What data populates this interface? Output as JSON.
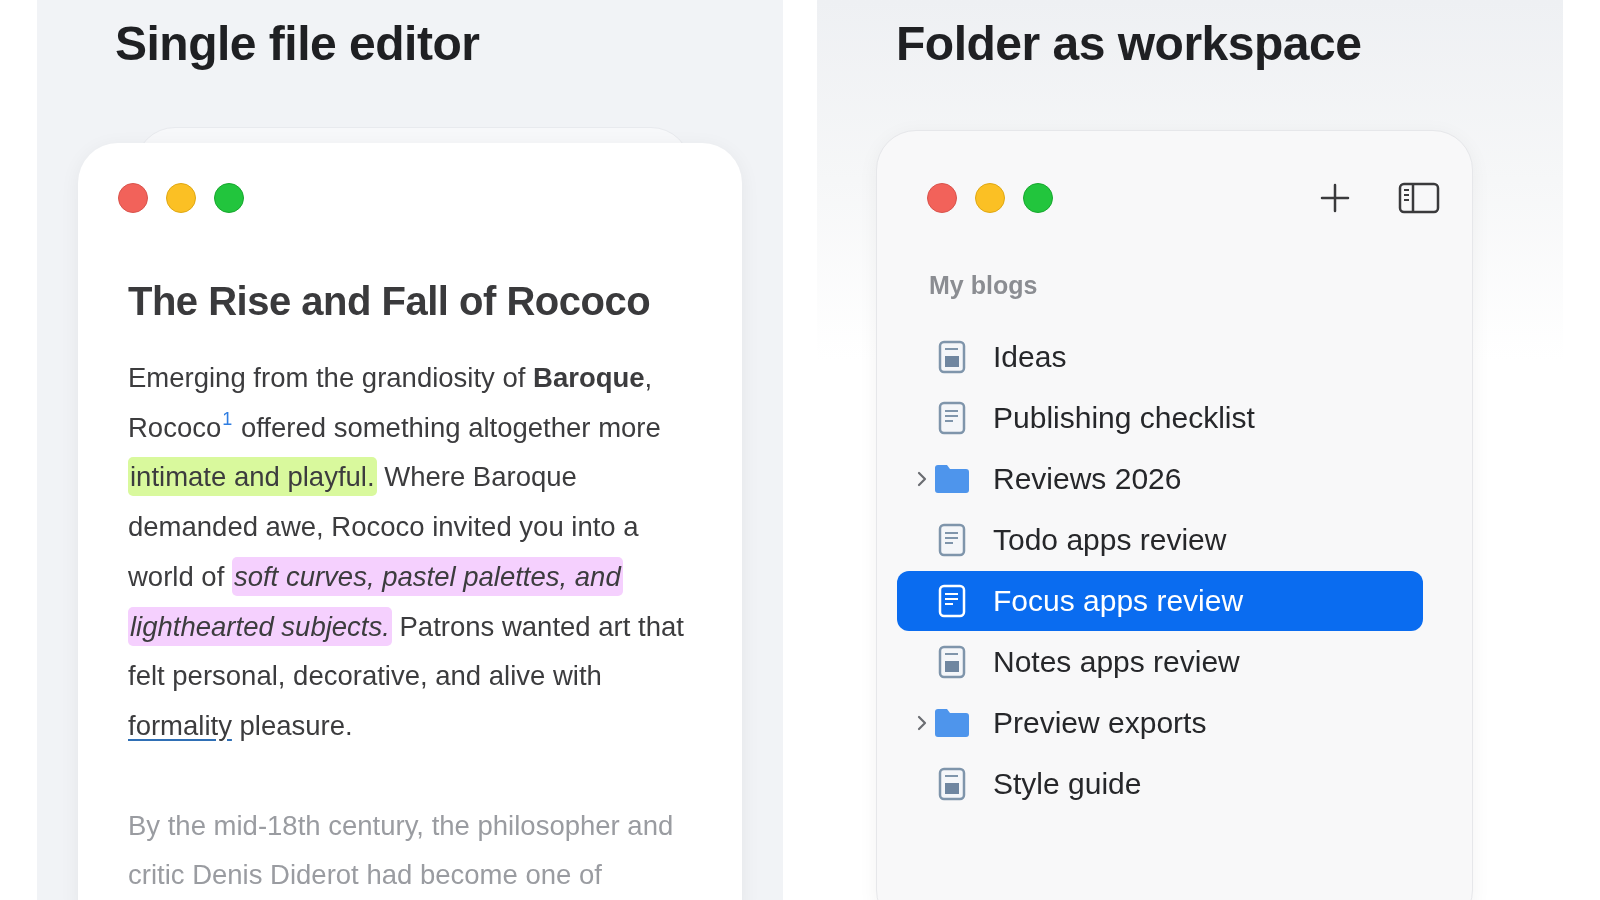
{
  "panels": [
    {
      "kind": "editor",
      "title": "Single file editor",
      "window": {
        "heading": "The Rise and Fall of Rococo",
        "paragraphs": [
          {
            "faded": false,
            "segments": [
              {
                "kind": "text",
                "text": "Emerging from the grandiosity of "
              },
              {
                "kind": "bold",
                "text": "Baroque"
              },
              {
                "kind": "text",
                "text": ", Rococo"
              },
              {
                "kind": "footnote",
                "text": "1"
              },
              {
                "kind": "text",
                "text": " offered something altogether more "
              },
              {
                "kind": "highlight",
                "text": "intimate and playful.",
                "color": "#d9f99d",
                "italic": false
              },
              {
                "kind": "text",
                "text": " Where Baroque demanded awe, Rococo invited you into a world of "
              },
              {
                "kind": "highlight",
                "text": "soft curves, pastel palettes, and lighthearted subjects.",
                "color": "#f5d0fe",
                "italic": true
              },
              {
                "kind": "text",
                "text": " Patrons wanted art that felt personal, decorative, and alive with "
              },
              {
                "kind": "link",
                "text": "formality"
              },
              {
                "kind": "text",
                "text": " pleasure."
              }
            ]
          },
          {
            "faded": true,
            "segments": [
              {
                "kind": "text",
                "text": "By the mid-18th century, the philosopher and critic Denis Diderot had become one of"
              }
            ]
          }
        ]
      }
    },
    {
      "kind": "workspace",
      "title": "Folder as workspace",
      "window": {
        "section": "My blogs",
        "items": [
          {
            "kind": "note",
            "label": "Ideas",
            "selected": false
          },
          {
            "kind": "page",
            "label": "Publishing checklist",
            "selected": false
          },
          {
            "kind": "folder",
            "label": "Reviews 2026",
            "selected": false,
            "expanded": false
          },
          {
            "kind": "page",
            "label": "Todo apps review",
            "selected": false
          },
          {
            "kind": "page",
            "label": "Focus apps review",
            "selected": true
          },
          {
            "kind": "note",
            "label": "Notes apps review",
            "selected": false
          },
          {
            "kind": "folder",
            "label": "Preview exports",
            "selected": false,
            "expanded": false
          },
          {
            "kind": "note",
            "label": "Style guide",
            "selected": false
          }
        ]
      }
    }
  ]
}
